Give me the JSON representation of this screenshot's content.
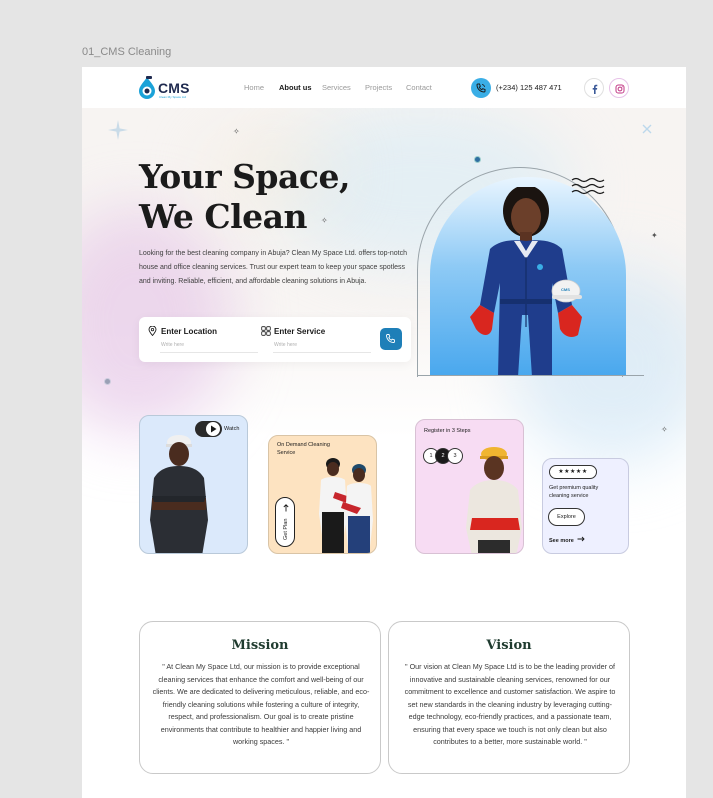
{
  "frame_label": "01_CMS Cleaning",
  "nav": {
    "logo_text": "CMS",
    "logo_sub": "Clean My Space Ltd",
    "links": [
      "Home",
      "About us",
      "Services",
      "Projects",
      "Contact"
    ],
    "active_link": "About us",
    "phone": "(+234) 125 487 471"
  },
  "hero": {
    "title_line1": "Your Space,",
    "title_line2": "We Clean",
    "paragraph": "Looking for the best cleaning company in Abuja? Clean My Space Ltd. offers top-notch house and office cleaning services. Trust our expert team to keep your space spotless and inviting. Reliable, efficient, and affordable cleaning solutions in Abuja.",
    "search": {
      "location_label": "Enter Location",
      "location_placeholder": "Write here",
      "service_label": "Enter Service",
      "service_placeholder": "Write here"
    }
  },
  "cards": {
    "watch": "Watch",
    "on_demand": "On Demand Cleaning Service",
    "get_plan": "Get Plan",
    "register": "Register in 3 Steps",
    "steps": [
      "1",
      "2",
      "3"
    ],
    "active_step": "2",
    "rating": 5,
    "rating_text": "★★★★★",
    "premium": "Get premium quality cleaning service",
    "explore": "Explore",
    "see_more": "See more"
  },
  "mission": {
    "title": "Mission",
    "body": "\" At Clean My Space Ltd, our mission is to provide exceptional cleaning services that enhance the comfort and well-being of our clients. We are dedicated to delivering meticulous, reliable, and eco-friendly cleaning solutions while fostering a culture of integrity, respect, and professionalism. Our goal is to create pristine environments that contribute to healthier and happier living and working spaces. \""
  },
  "vision": {
    "title": "Vision",
    "body": "\" Our vision at Clean My Space Ltd is to be the leading provider of innovative and sustainable cleaning services, renowned for our commitment to excellence and customer satisfaction. We aspire to set new standards in the cleaning industry by leveraging cutting-edge technology, eco-friendly practices, and a passionate team, ensuring that every space we touch is not only clean but also contributes to a better, more sustainable world. \""
  },
  "colors": {
    "brand_blue": "#1e7fb8",
    "accent_blue": "#3aaee6",
    "navy": "#1f2a4f",
    "mission_title": "#1f3b2f"
  },
  "icons": [
    "phone-icon",
    "facebook-icon",
    "instagram-icon",
    "location-pin-icon",
    "grid-icon",
    "play-icon",
    "arrow-up-icon",
    "arrow-right-icon"
  ]
}
